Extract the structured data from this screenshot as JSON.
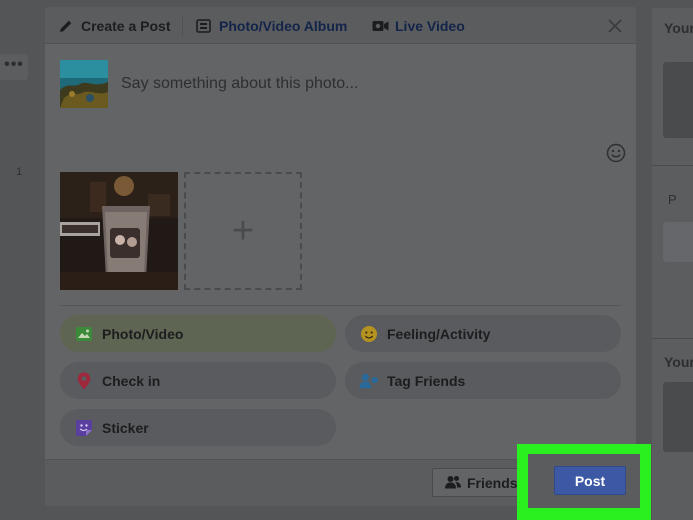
{
  "header": {
    "tabs": [
      {
        "label": "Create a Post",
        "icon": "pencil-icon"
      },
      {
        "label": "Photo/Video Album",
        "icon": "album-icon"
      },
      {
        "label": "Live Video",
        "icon": "video-camera-icon"
      }
    ],
    "close_icon": "close-icon"
  },
  "composer": {
    "placeholder": "Say something about this photo...",
    "emoji_icon": "smiley-icon"
  },
  "attachments": {
    "add_label": "+"
  },
  "options": [
    {
      "label": "Photo/Video",
      "icon": "photo-icon",
      "color": "#3a8a3a",
      "active": true
    },
    {
      "label": "Feeling/Activity",
      "icon": "feeling-icon",
      "color": "#b59320"
    },
    {
      "label": "Check in",
      "icon": "location-pin-icon",
      "color": "#a0283c"
    },
    {
      "label": "Tag Friends",
      "icon": "tag-friends-icon",
      "color": "#2a6a9a"
    },
    {
      "label": "Sticker",
      "icon": "sticker-icon",
      "color": "#5b3fa0"
    }
  ],
  "footer": {
    "audience_label": "Friends",
    "post_label": "Post"
  },
  "background": {
    "right_titles": [
      "Your",
      "Your"
    ],
    "right_p": "P",
    "dots": "•••",
    "left_number": "1"
  },
  "colors": {
    "highlight": "#2bf020",
    "post_button": "#3d59a5",
    "brand_link": "#13244a"
  }
}
